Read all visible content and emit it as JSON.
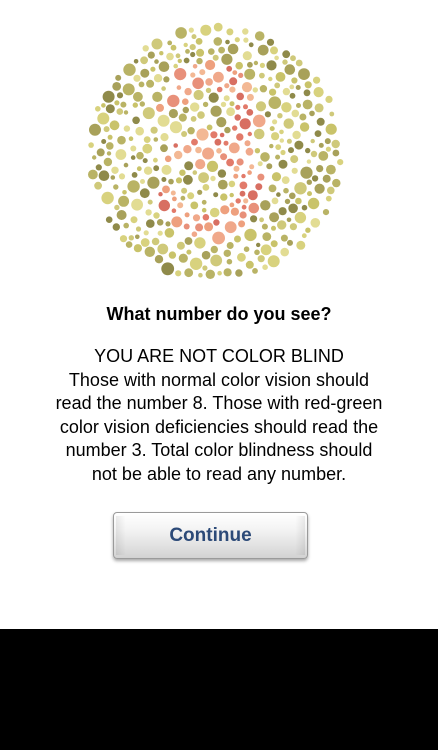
{
  "plate": {
    "icon": "ishihara-plate-icon",
    "colors": {
      "background_dots": [
        "#c9c36a",
        "#d8d27e",
        "#a8a15a",
        "#b9b365",
        "#e2dc93",
        "#8f8a4a",
        "#cfc97a"
      ],
      "figure_dots": [
        "#e8907a",
        "#f0a88a",
        "#e27a6a",
        "#f3b894",
        "#d86f62",
        "#eea07e"
      ]
    }
  },
  "question": "What number do you see?",
  "result": {
    "lines": [
      "YOU ARE NOT COLOR BLIND",
      "Those with normal color vision should",
      "read the number 8. Those with red-green",
      "color vision deficiencies should read the",
      "number 3. Total color blindness should",
      "not be able to read any number."
    ]
  },
  "continue_button": {
    "label": "Continue"
  }
}
